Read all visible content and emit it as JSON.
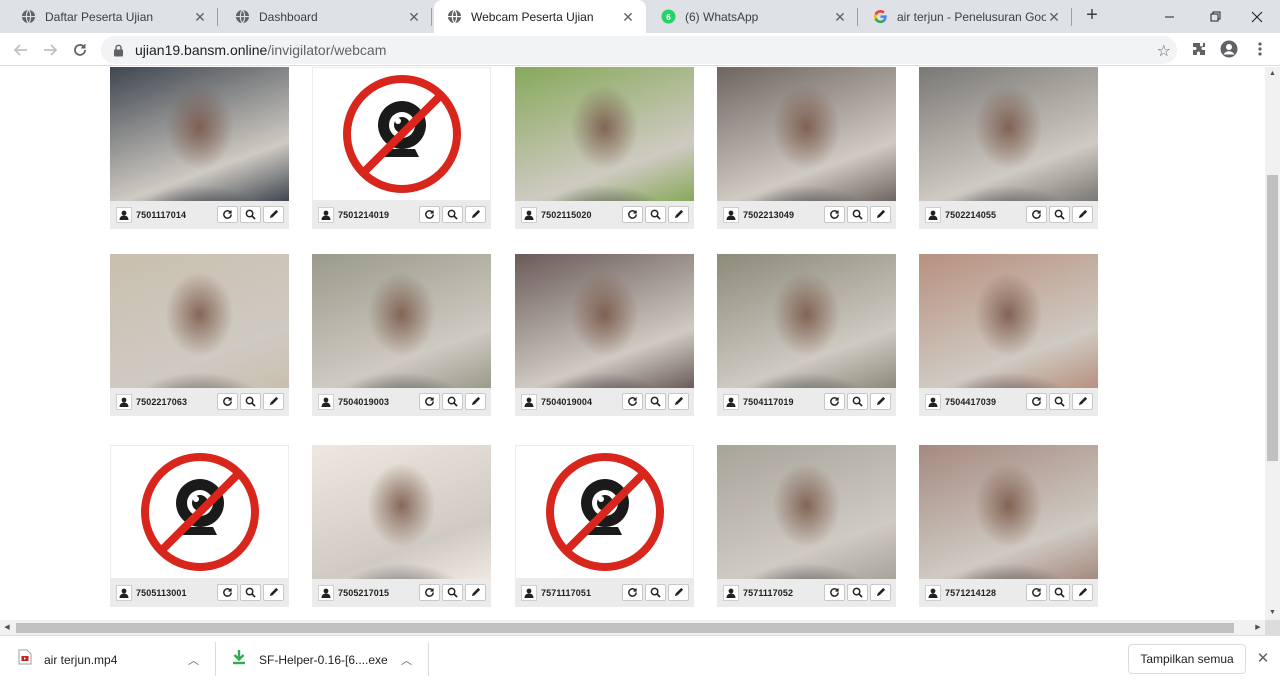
{
  "tabs": [
    {
      "title": "Daftar Peserta Ujian",
      "favicon": "globe-icon",
      "active": false
    },
    {
      "title": "Dashboard",
      "favicon": "globe-icon",
      "active": false
    },
    {
      "title": "Webcam Peserta Ujian",
      "favicon": "globe-icon",
      "active": true
    },
    {
      "title": "(6) WhatsApp",
      "favicon": "whatsapp-icon",
      "badge": "6",
      "active": false
    },
    {
      "title": "air terjun - Penelusuran Google",
      "favicon": "google-icon",
      "active": false
    }
  ],
  "address": {
    "host": "ujian19.bansm.online",
    "path": "/invigilator/webcam"
  },
  "participants": [
    {
      "id": "7501117014",
      "webcam": "on",
      "tone": "#3e4650"
    },
    {
      "id": "7501214019",
      "webcam": "off"
    },
    {
      "id": "7502115020",
      "webcam": "on",
      "tone": "#86a95a"
    },
    {
      "id": "7502213049",
      "webcam": "on",
      "tone": "#6f6560"
    },
    {
      "id": "7502214055",
      "webcam": "on",
      "tone": "#7a7875"
    },
    {
      "id": "7502217063",
      "webcam": "on",
      "tone": "#c9bfae"
    },
    {
      "id": "7504019003",
      "webcam": "on",
      "tone": "#9a9a8a"
    },
    {
      "id": "7504019004",
      "webcam": "on",
      "tone": "#6b5b58"
    },
    {
      "id": "7504117019",
      "webcam": "on",
      "tone": "#8d8a7a"
    },
    {
      "id": "7504417039",
      "webcam": "on",
      "tone": "#b8907f"
    },
    {
      "id": "7505113001",
      "webcam": "off"
    },
    {
      "id": "7505217015",
      "webcam": "on",
      "tone": "#efe8e0"
    },
    {
      "id": "7571117051",
      "webcam": "off"
    },
    {
      "id": "7571117052",
      "webcam": "on",
      "tone": "#a9a49a"
    },
    {
      "id": "7571214128",
      "webcam": "on",
      "tone": "#a58a80"
    }
  ],
  "card_actions": [
    "refresh-icon",
    "zoom-icon",
    "edit-icon"
  ],
  "downloads": [
    {
      "name": "air terjun.mp4",
      "icon": "video-file-icon"
    },
    {
      "name": "SF-Helper-0.16-[6....exe",
      "icon": "download-arrow-icon"
    }
  ],
  "show_all_label": "Tampilkan semua",
  "colors": {
    "accent": "#1a73e8",
    "nocam_red": "#d9261c",
    "whatsapp": "#25d366"
  }
}
